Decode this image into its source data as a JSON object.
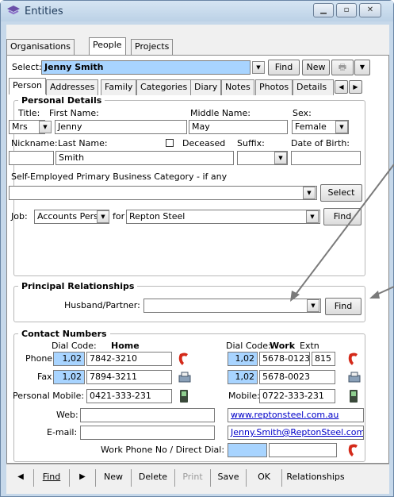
{
  "window": {
    "title": "Entities"
  },
  "top_tabs": [
    "Organisations",
    "People",
    "Projects"
  ],
  "select": {
    "label": "Select:",
    "value": "Jenny Smith",
    "find": "Find",
    "new": "New"
  },
  "sub_tabs": [
    "Person",
    "Addresses",
    "Family",
    "Categories",
    "Diary",
    "Notes",
    "Photos",
    "Details"
  ],
  "personal": {
    "section_title": "Personal Details",
    "title_label": "Title:",
    "title_value": "Mrs",
    "first_label": "First Name:",
    "first_value": "Jenny",
    "middle_label": "Middle Name:",
    "middle_value": "May",
    "sex_label": "Sex:",
    "sex_value": "Female",
    "nickname_label": "Nickname:",
    "last_label": "Last Name:",
    "last_value": "Smith",
    "deceased_label": "Deceased",
    "suffix_label": "Suffix:",
    "dob_label": "Date of Birth:",
    "selfemp_label": "Self-Employed Primary Business Category - if any",
    "select_btn": "Select",
    "job_label": "Job:",
    "job_value": "Accounts Persor",
    "for_label": "for",
    "for_value": "Repton Steel",
    "find_btn": "Find"
  },
  "relationships": {
    "section_title": "Principal Relationships",
    "partner_label": "Husband/Partner:",
    "find_btn": "Find"
  },
  "contact": {
    "section_title": "Contact Numbers",
    "dial_code_label": "Dial Code:",
    "home_label": "Home",
    "work_label": "Work",
    "extn_label": "Extn",
    "phone_label": "Phone:",
    "fax_label": "Fax:",
    "home_phone_code": "1,02",
    "home_phone": "7842-3210",
    "home_fax_code": "1,02",
    "home_fax": "7894-3211",
    "work_phone_code": "1,02",
    "work_phone": "5678-0123",
    "work_extn": "815",
    "work_fax_code": "1,02",
    "work_fax": "5678-0023",
    "pmobile_label": "Personal Mobile:",
    "pmobile_value": "0421-333-231",
    "mobile_label": "Mobile:",
    "mobile_value": "0722-333-231",
    "web_label": "Web:",
    "web_value": "www.reptonsteel.com.au",
    "email_label": "E-mail:",
    "email_value": "Jenny.Smith@ReptonSteel.com.a",
    "direct_label": "Work Phone No / Direct Dial:"
  },
  "nav": {
    "find": "Find",
    "new": "New",
    "delete": "Delete",
    "print": "Print",
    "save": "Save",
    "ok": "OK",
    "relationships": "Relationships"
  }
}
